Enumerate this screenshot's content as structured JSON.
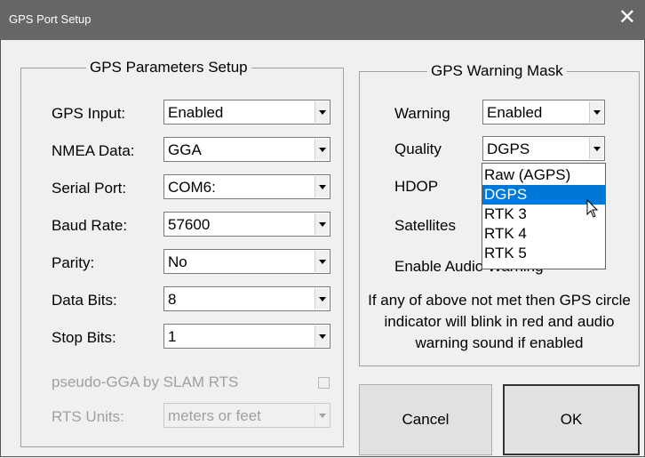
{
  "window": {
    "title": "GPS Port Setup",
    "close_glyph": "✕"
  },
  "gps_params": {
    "title": "GPS Parameters Setup",
    "rows": [
      {
        "label": "GPS Input:",
        "value": "Enabled"
      },
      {
        "label": "NMEA Data:",
        "value": "GGA"
      },
      {
        "label": "Serial Port:",
        "value": "COM6:"
      },
      {
        "label": "Baud Rate:",
        "value": "57600"
      },
      {
        "label": "Parity:",
        "value": "No"
      },
      {
        "label": "Data Bits:",
        "value": "8"
      },
      {
        "label": "Stop Bits:",
        "value": "1"
      }
    ],
    "pseudo_gga_label": "pseudo-GGA by SLAM RTS",
    "pseudo_gga_checked": false,
    "rts_units_label": "RTS Units:",
    "rts_units_value": "meters or feet"
  },
  "warning_mask": {
    "title": "GPS Warning Mask",
    "warning_label": "Warning",
    "warning_value": "Enabled",
    "quality_label": "Quality",
    "quality_value": "DGPS",
    "hdop_label": "HDOP",
    "satellites_label": "Satellites",
    "enable_audio_label": "Enable Audio Warning",
    "quality_options": [
      "Raw (AGPS)",
      "DGPS",
      "RTK 3",
      "RTK 4",
      "RTK 5"
    ],
    "quality_highlighted": "DGPS",
    "note": "If any of above not met then GPS circle indicator will blink in red and audio warning sound if enabled"
  },
  "buttons": {
    "cancel": "Cancel",
    "ok": "OK"
  },
  "colors": {
    "titlebar": "#666666",
    "selection": "#0078d7",
    "disabled_text": "#a0a0a0"
  },
  "icons": {
    "cursor": "arrow-pointer-icon"
  }
}
